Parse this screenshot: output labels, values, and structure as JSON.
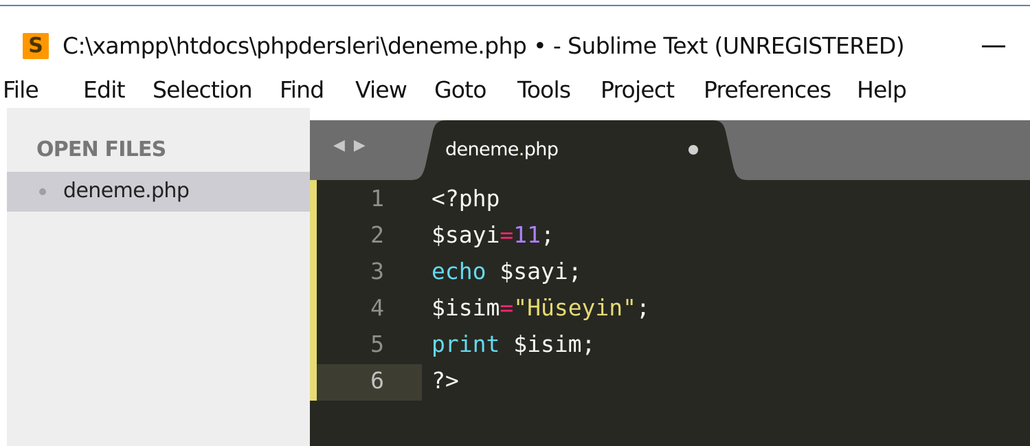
{
  "window": {
    "title": "C:\\xampp\\htdocs\\phpdersleri\\deneme.php • - Sublime Text (UNREGISTERED)",
    "app_icon_letter": "S",
    "minimize_icon": "minimize-icon"
  },
  "menu": {
    "items": [
      "File",
      "Edit",
      "Selection",
      "Find",
      "View",
      "Goto",
      "Tools",
      "Project",
      "Preferences",
      "Help"
    ]
  },
  "sidebar": {
    "header": "OPEN FILES",
    "files": [
      {
        "name": "deneme.php",
        "selected": true
      }
    ]
  },
  "tabs": {
    "nav_arrows": "◀ ▶",
    "active": {
      "label": "deneme.php",
      "dirty": true
    }
  },
  "editor": {
    "current_line": 6,
    "lines": [
      {
        "num": "1",
        "tokens": [
          {
            "t": "<?php",
            "c": "tag"
          }
        ]
      },
      {
        "num": "2",
        "tokens": [
          {
            "t": "$sayi",
            "c": "var"
          },
          {
            "t": "=",
            "c": "op"
          },
          {
            "t": "11",
            "c": "num"
          },
          {
            "t": ";",
            "c": "var"
          }
        ]
      },
      {
        "num": "3",
        "tokens": [
          {
            "t": "echo",
            "c": "kw"
          },
          {
            "t": " $sayi;",
            "c": "var"
          }
        ]
      },
      {
        "num": "4",
        "tokens": [
          {
            "t": "$isim",
            "c": "var"
          },
          {
            "t": "=",
            "c": "op"
          },
          {
            "t": "\"Hüseyin\"",
            "c": "str"
          },
          {
            "t": ";",
            "c": "var"
          }
        ]
      },
      {
        "num": "5",
        "tokens": [
          {
            "t": "print",
            "c": "kw"
          },
          {
            "t": " $isim;",
            "c": "var"
          }
        ]
      },
      {
        "num": "6",
        "tokens": [
          {
            "t": "?>",
            "c": "tag"
          }
        ]
      }
    ]
  },
  "colors": {
    "editor_bg": "#272822",
    "keyword": "#66d9ef",
    "operator": "#f92672",
    "number": "#ae81ff",
    "string": "#e6db74",
    "modified_marker": "#e6db74",
    "app_icon": "#ff9800"
  }
}
